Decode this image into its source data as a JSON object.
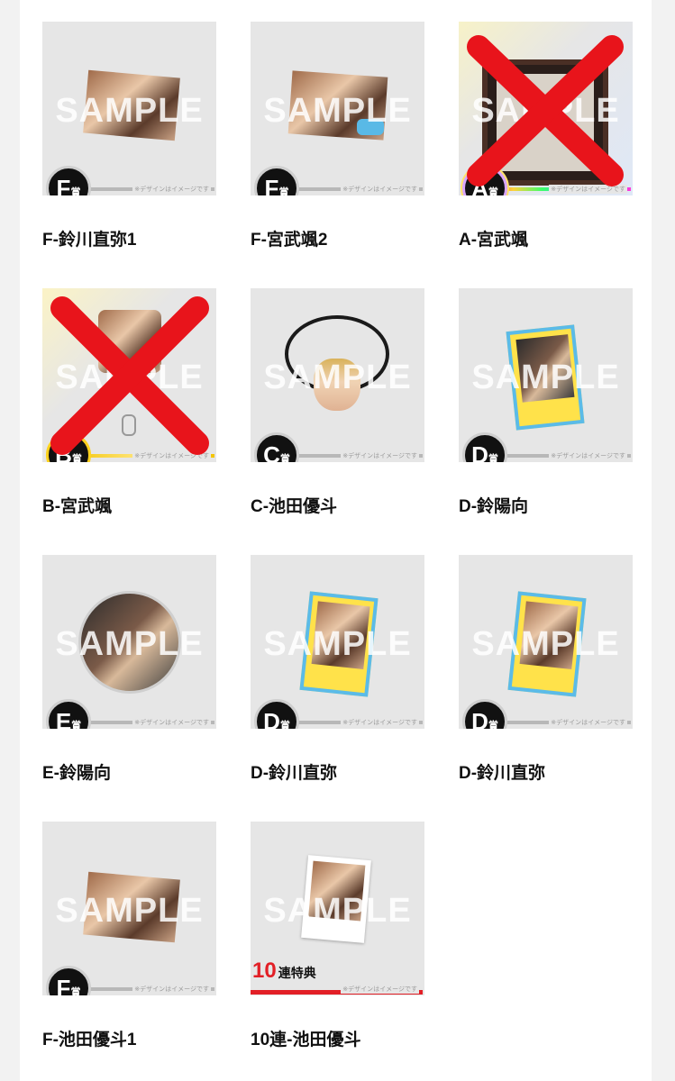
{
  "sample_watermark": "SAMPLE",
  "disclaimer": "※デザインはイメージです",
  "items": [
    {
      "badge": "F",
      "badge_suffix": "賞",
      "caption": "F-鈴川直弥1",
      "crossed": false
    },
    {
      "badge": "F",
      "badge_suffix": "賞",
      "caption": "F-宮武颯2",
      "crossed": false
    },
    {
      "badge": "A",
      "badge_suffix": "賞",
      "caption": "A-宮武颯",
      "crossed": true
    },
    {
      "badge": "B",
      "badge_suffix": "賞",
      "caption": "B-宮武颯",
      "crossed": true
    },
    {
      "badge": "C",
      "badge_suffix": "賞",
      "caption": "C-池田優斗",
      "crossed": false
    },
    {
      "badge": "D",
      "badge_suffix": "賞",
      "caption": "D-鈴陽向",
      "crossed": false
    },
    {
      "badge": "E",
      "badge_suffix": "賞",
      "caption": "E-鈴陽向",
      "crossed": false
    },
    {
      "badge": "D",
      "badge_suffix": "賞",
      "caption": "D-鈴川直弥",
      "crossed": false
    },
    {
      "badge": "D",
      "badge_suffix": "賞",
      "caption": "D-鈴川直弥",
      "crossed": false
    },
    {
      "badge": "F",
      "badge_suffix": "賞",
      "caption": "F-池田優斗1",
      "crossed": false
    },
    {
      "bonus_number": "10",
      "bonus_text": "連特典",
      "caption": "10連-池田優斗",
      "crossed": false
    }
  ],
  "colors": {
    "accent_red": "#e21f26",
    "badge_black": "#111111",
    "tile_gray": "#e6e6e6"
  }
}
